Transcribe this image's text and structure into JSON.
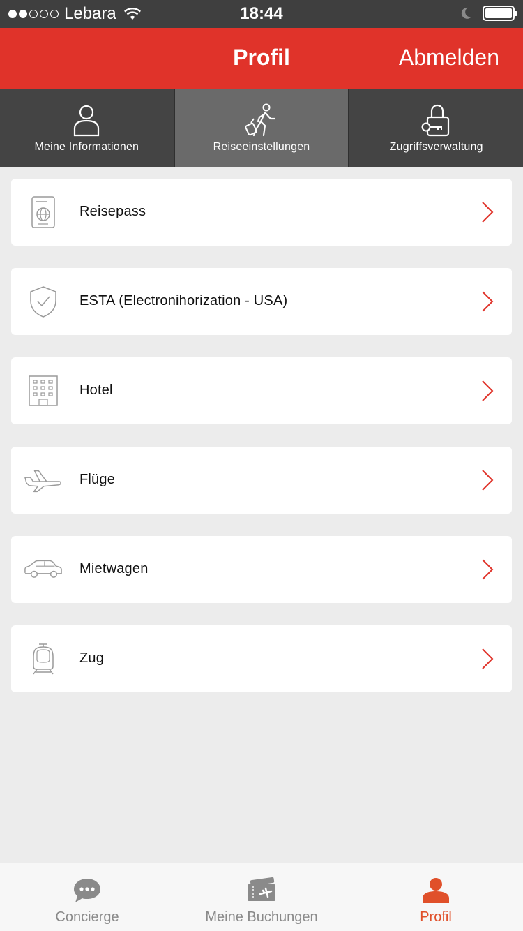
{
  "status_bar": {
    "carrier": "Lebara",
    "time": "18:44",
    "signal_dots_filled": 2,
    "signal_dots_total": 5
  },
  "header": {
    "title": "Profil",
    "logout_label": "Abmelden",
    "color": "#e0332a"
  },
  "tabs": [
    {
      "label": "Meine Informationen",
      "icon": "person-icon",
      "active": false
    },
    {
      "label": "Reiseeinstellungen",
      "icon": "traveler-icon",
      "active": true
    },
    {
      "label": "Zugriffsverwaltung",
      "icon": "lock-key-icon",
      "active": false
    }
  ],
  "items": [
    {
      "label": "Reisepass",
      "icon": "passport-icon"
    },
    {
      "label": "ESTA (Electronihorization - USA)",
      "icon": "shield-icon"
    },
    {
      "label": "Hotel",
      "icon": "hotel-icon"
    },
    {
      "label": "Flüge",
      "icon": "airplane-icon"
    },
    {
      "label": "Mietwagen",
      "icon": "car-icon"
    },
    {
      "label": "Zug",
      "icon": "train-icon"
    }
  ],
  "bottom_nav": [
    {
      "label": "Concierge",
      "icon": "chat-icon",
      "active": false
    },
    {
      "label": "Meine Buchungen",
      "icon": "ticket-icon",
      "active": false
    },
    {
      "label": "Profil",
      "icon": "profile-icon",
      "active": true
    }
  ],
  "colors": {
    "accent": "#e0332a",
    "active_nav": "#e0502a",
    "chevron": "#e0332a"
  }
}
